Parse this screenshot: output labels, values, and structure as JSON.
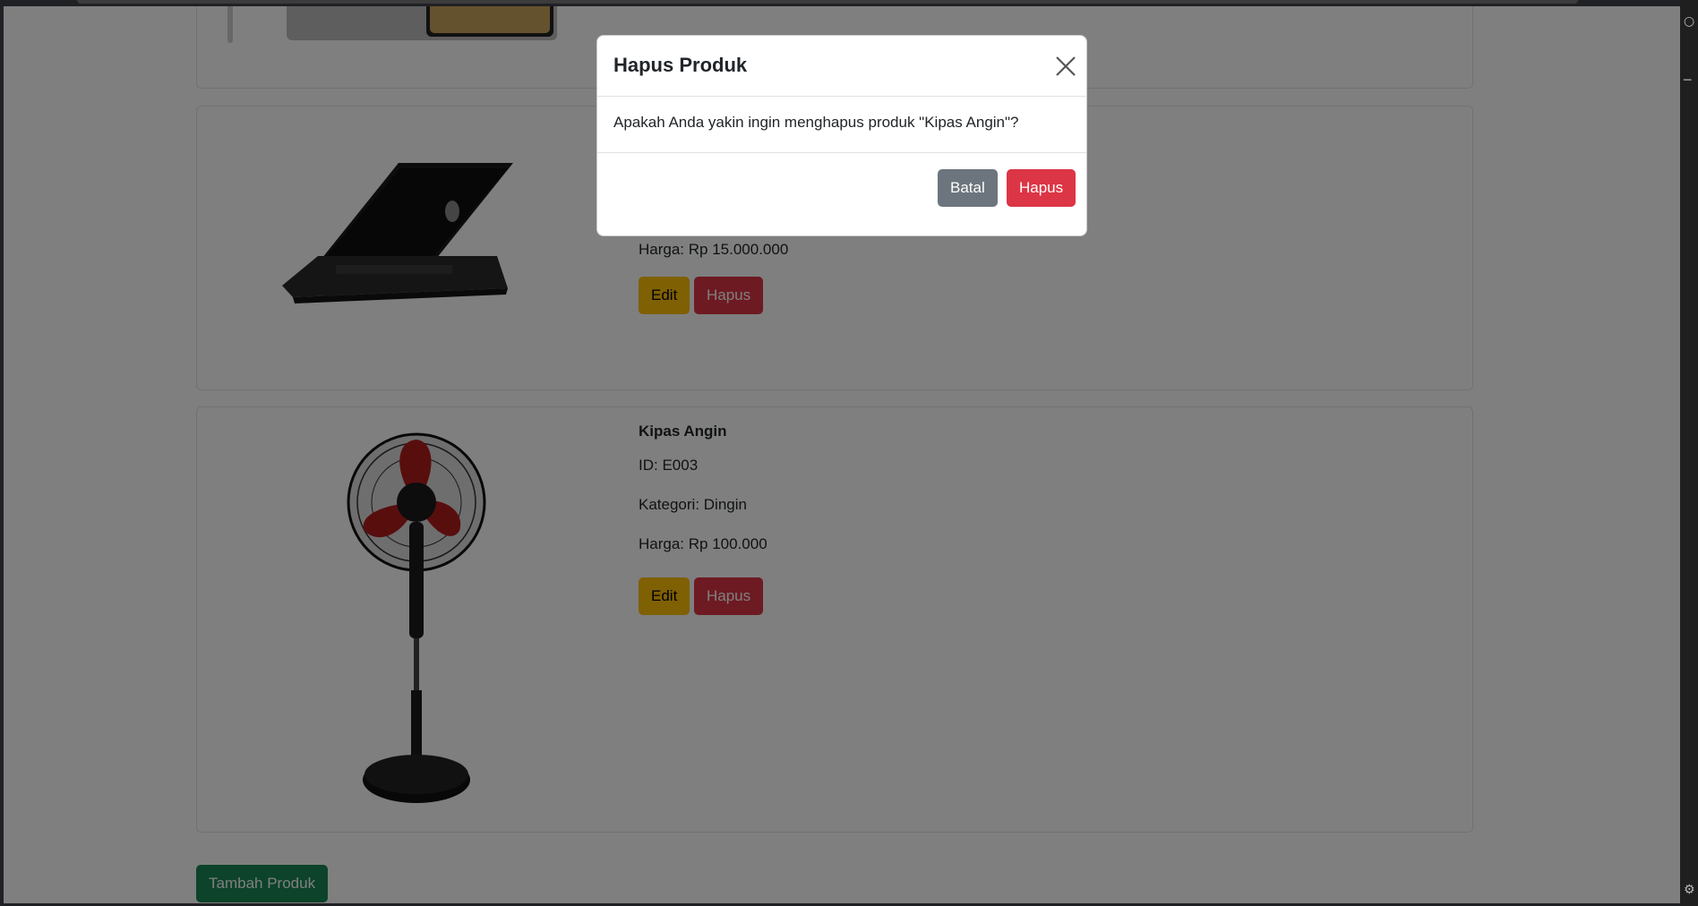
{
  "products": [
    {
      "name": "Kipas Angin",
      "id_label": "ID: E003",
      "category_label": "Kategori: Dingin",
      "price_label": "Harga: Rp 100.000",
      "edit_label": "Edit",
      "delete_label": "Hapus"
    }
  ],
  "laptop_card": {
    "price_label": "Harga: Rp 15.000.000",
    "edit_label": "Edit",
    "delete_label": "Hapus"
  },
  "add_button_label": "Tambah Produk",
  "modal": {
    "title": "Hapus Produk",
    "message": "Apakah Anda yakin ingin menghapus produk \"Kipas Angin\"?",
    "cancel_label": "Batal",
    "confirm_label": "Hapus"
  },
  "colors": {
    "warning": "#ffc107",
    "danger": "#dc3545",
    "success": "#198754",
    "secondary": "#6c757d"
  }
}
